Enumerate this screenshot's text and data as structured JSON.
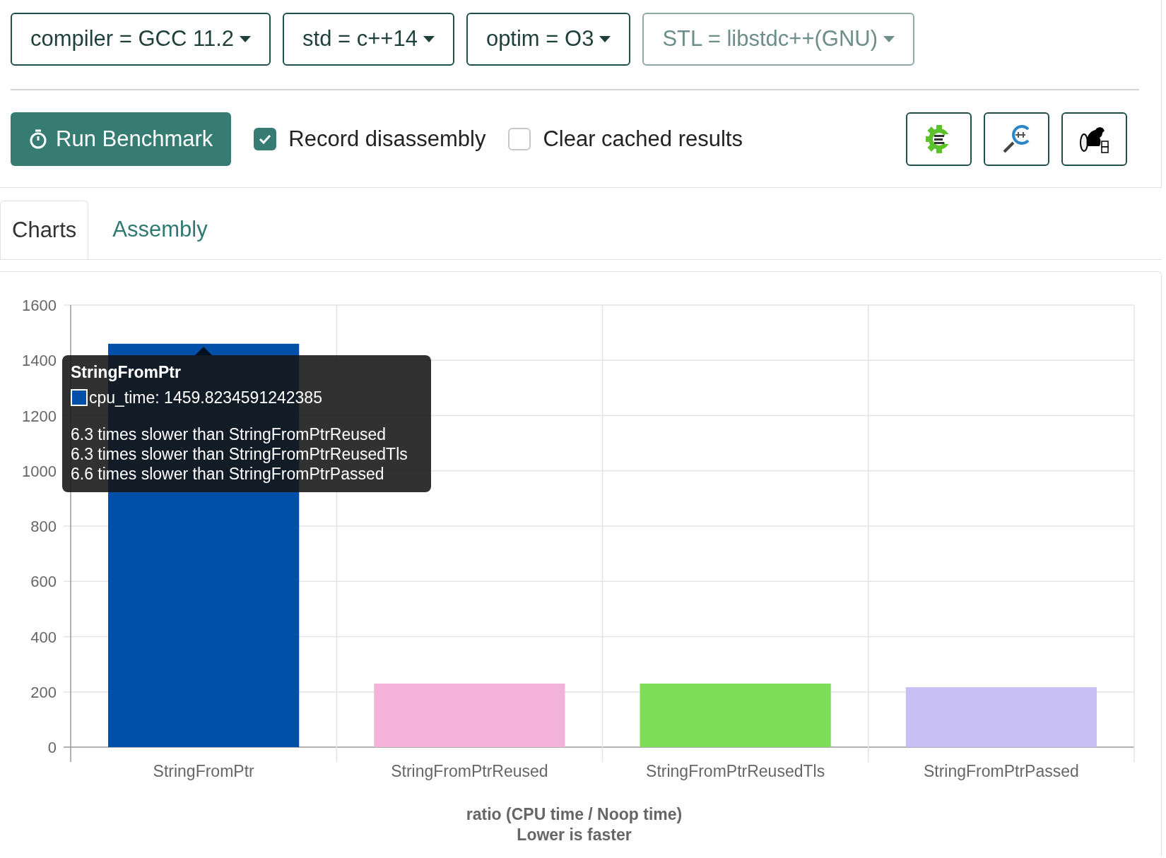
{
  "selectors": [
    {
      "label": "compiler = GCC 11.2",
      "disabled": false
    },
    {
      "label": "std = c++14",
      "disabled": false
    },
    {
      "label": "optim = O3",
      "disabled": false
    },
    {
      "label": "STL = libstdc++(GNU)",
      "disabled": true
    }
  ],
  "run_button": "Run Benchmark",
  "options": [
    {
      "label": "Record disassembly",
      "checked": true
    },
    {
      "label": "Clear cached results",
      "checked": false
    }
  ],
  "tabs": [
    {
      "label": "Charts",
      "selected": true
    },
    {
      "label": "Assembly",
      "selected": false
    }
  ],
  "chart": {
    "xlabel_note": "Lower is faster",
    "chart_data": {
      "type": "bar",
      "xlabel": "ratio (CPU time / Noop time)",
      "categories": [
        "StringFromPtr",
        "StringFromPtrReused",
        "StringFromPtrReusedTls",
        "StringFromPtrPassed"
      ],
      "series": [
        {
          "color": "#0050aa",
          "values": [
            1460,
            null,
            null,
            null
          ]
        },
        {
          "color": "#f3b3d9",
          "values": [
            null,
            230,
            null,
            null
          ]
        },
        {
          "color": "#7ddd58",
          "values": [
            null,
            null,
            230,
            null
          ]
        },
        {
          "color": "#c8c0f2",
          "values": [
            null,
            null,
            null,
            217
          ]
        }
      ],
      "stacked": true,
      "grid": true,
      "ylim": [
        0,
        1600
      ],
      "yticks": [
        0,
        200,
        400,
        600,
        800,
        1000,
        1200,
        1400,
        1600
      ]
    },
    "tooltip": {
      "title": "StringFromPtr",
      "value": "cpu_time: 1459.8234591242385",
      "color": "#0050aa",
      "lines": [
        "6.3 times slower than StringFromPtrReused",
        "6.3 times slower than StringFromPtrReusedTls",
        "6.6 times slower than StringFromPtrPassed"
      ]
    }
  }
}
